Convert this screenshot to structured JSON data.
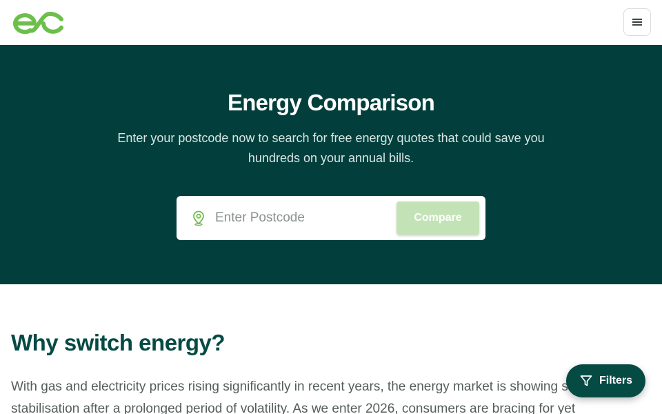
{
  "header": {
    "logo_icon": "ec-logo",
    "menu_icon": "hamburger-menu-icon"
  },
  "hero": {
    "title": "Energy Comparison",
    "subtitle": "Enter your postcode now to search for free energy quotes that could save you hundreds on your annual bills.",
    "search": {
      "icon": "map-pin-icon",
      "placeholder": "Enter Postcode",
      "value": "",
      "button_label": "Compare"
    }
  },
  "content": {
    "heading": "Why switch energy?",
    "body": "With gas and electricity prices rising significantly in recent years, the energy market is showing signs of stabilisation after a prolonged period of volatility. As we enter 2026, consumers are bracing for yet"
  },
  "filters_button": {
    "icon": "filter-icon",
    "label": "Filters"
  },
  "colors": {
    "brand_dark": "#023f3c",
    "brand_green": "#6cbf4b",
    "compare_disabled": "#c3e3b7",
    "heading": "#064a44"
  }
}
